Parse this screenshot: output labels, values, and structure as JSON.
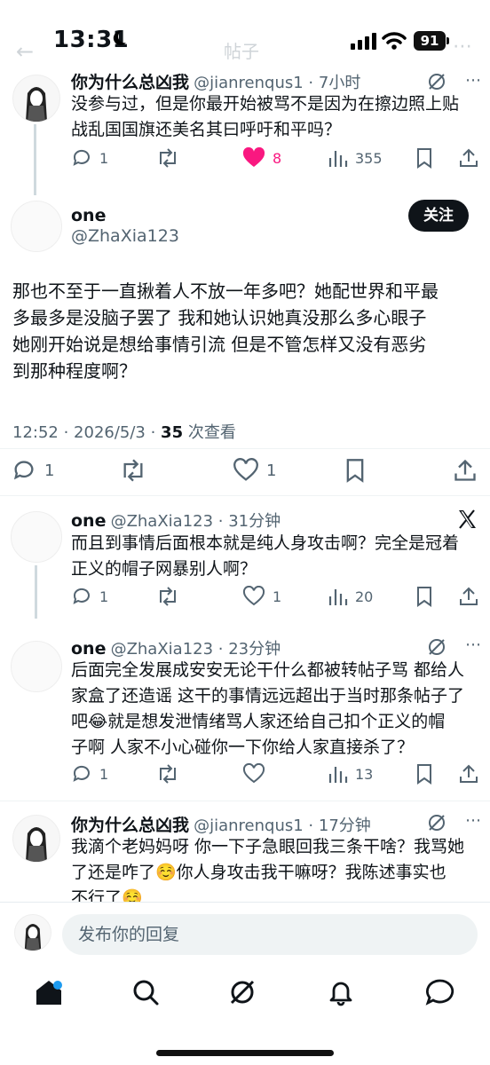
{
  "status_bar": {
    "time": "13:31",
    "battery": "91"
  },
  "header": {
    "faded_title": "帖子"
  },
  "parent_tweet": {
    "display_name": "你为什么总凶我",
    "handle_time": "@jianrenqus1 · 7小时",
    "text_line1": "没参与过，但是你最开始被骂不是因为在擦边照上贴",
    "text_line2": "战乱国国旗还美名其曰呼吁和平吗？",
    "replies": "1",
    "likes": "8",
    "views": "355"
  },
  "main_tweet": {
    "display_name": "one",
    "handle": "@ZhaXia123",
    "follow_label": "关注",
    "text_line1": "那也不至于一直揪着人不放一年多吧？她配世界和平最",
    "text_line2": "多最多是没脑子罢了 我和她认识她真没那么多心眼子",
    "text_line3": "她刚开始说是想给事情引流 但是不管怎样又没有恶劣",
    "text_line4": "到那种程度啊？",
    "timestamp": "12:52 · 2026/5/3 · ",
    "view_count": "35",
    "view_label": " 次查看",
    "replies": "1",
    "likes": "1"
  },
  "replies": [
    {
      "display_name": "one",
      "handle_time": "@ZhaXia123 · 31分钟",
      "text_line1": "而且到事情后面根本就是纯人身攻击啊？完全是冠着",
      "text_line2": "正义的帽子网暴别人啊？",
      "likes": "1",
      "views": "20"
    },
    {
      "display_name": "one",
      "handle_time": "@ZhaXia123 · 23分钟",
      "text_line1": "后面完全发展成安安无论干什么都被转帖子骂 都给人",
      "text_line2": "家盒了还造谣 这干的事情远远超出于当时那条帖子了",
      "text_line3": "吧😂就是想发泄情绪骂人家还给自己扣个正义的帽",
      "text_line4": "子啊 人家不小心碰你一下你给人家直接杀了？",
      "views": "13"
    },
    {
      "display_name": "你为什么总凶我",
      "handle_time": "@jianrenqus1 · 17分钟",
      "text_line1": "我滴个老妈妈呀 你一下子急眼回我三条干啥？我骂她",
      "text_line2": "了还是咋了☺️你人身攻击我干嘛呀？我陈述事实也",
      "text_line3": "不行了☺️"
    }
  ],
  "reply_box": {
    "placeholder": "发布你的回复"
  },
  "colors": {
    "like_pink": "#f91880",
    "text_gray": "#536471",
    "follow_bg": "#0f1419"
  }
}
